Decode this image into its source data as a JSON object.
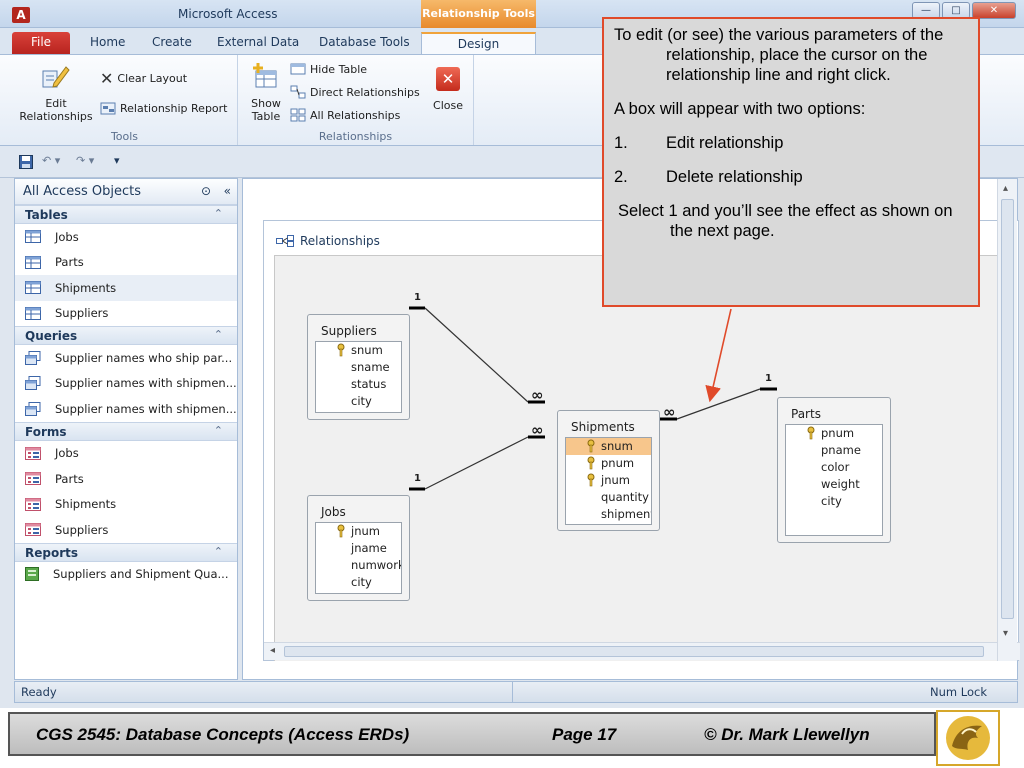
{
  "window": {
    "app_letter": "A",
    "title": "Microsoft Access",
    "contextual_tab": "Relationship Tools",
    "min_glyph": "—",
    "max_glyph": "□",
    "close_glyph": "✕"
  },
  "ribbon_tabs": [
    "File",
    "Home",
    "Create",
    "External Data",
    "Database Tools",
    "Design"
  ],
  "ribbon": {
    "tools_group": {
      "label": "Tools",
      "edit_relationships": "Edit Relationships",
      "clear_layout": "Clear Layout",
      "relationship_report": "Relationship Report"
    },
    "relationships_group": {
      "label": "Relationships",
      "show_table": "Show Table",
      "hide_table": "Hide Table",
      "direct_relationships": "Direct Relationships",
      "all_relationships": "All Relationships",
      "close": "Close"
    }
  },
  "nav": {
    "header": "All Access Objects",
    "sections": [
      {
        "title": "Tables",
        "items": [
          "Jobs",
          "Parts",
          "Shipments",
          "Suppliers"
        ]
      },
      {
        "title": "Queries",
        "items": [
          "Supplier names who ship par...",
          "Supplier names with shipmen...",
          "Supplier names with shipmen..."
        ]
      },
      {
        "title": "Forms",
        "items": [
          "Jobs",
          "Parts",
          "Shipments",
          "Suppliers"
        ]
      },
      {
        "title": "Reports",
        "items": [
          "Suppliers and Shipment Qua..."
        ]
      }
    ]
  },
  "document": {
    "tab_title": "Relationships",
    "tables": {
      "suppliers": {
        "name": "Suppliers",
        "fields": [
          "snum",
          "sname",
          "status",
          "city"
        ]
      },
      "jobs": {
        "name": "Jobs",
        "fields": [
          "jnum",
          "jname",
          "numwork",
          "city"
        ]
      },
      "shipments": {
        "name": "Shipments",
        "fields": [
          "snum",
          "pnum",
          "jnum",
          "quantity",
          "shipment"
        ]
      },
      "parts": {
        "name": "Parts",
        "fields": [
          "pnum",
          "pname",
          "color",
          "weight",
          "city"
        ]
      }
    },
    "one_label": "1",
    "many_label": "∞"
  },
  "status": {
    "left": "Ready",
    "right": "Num Lock"
  },
  "callout": {
    "p1": "To edit (or see) the various parameters of the relationship, place the cursor on the relationship line and right click.",
    "p2": "A box will appear with two options:",
    "item1_num": "1.",
    "item1": "Edit relationship",
    "item2_num": "2.",
    "item2": "Delete relationship",
    "p3": "Select 1 and you’ll see the effect as shown on the next page."
  },
  "footer": {
    "course": "CGS 2545: Database Concepts  (Access ERDs)",
    "page": "Page 17",
    "author": "© Dr. Mark Llewellyn"
  },
  "colors": {
    "accent": "#e04a2a",
    "file_tab": "#b8241f",
    "context_tab": "#e88a2c",
    "selected_field": "#f7c68c"
  }
}
